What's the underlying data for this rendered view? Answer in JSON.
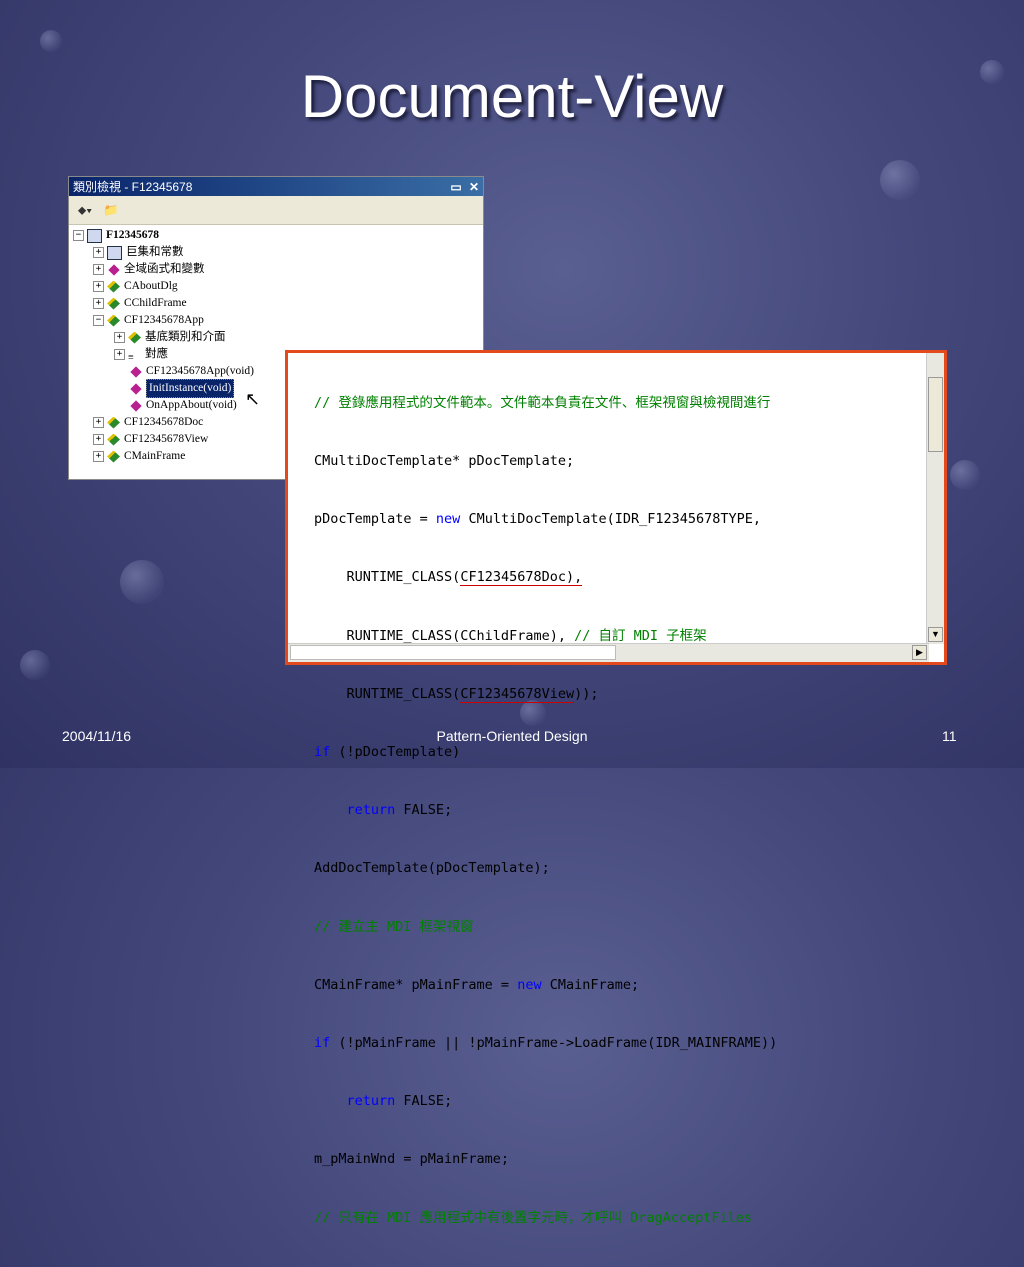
{
  "slide": {
    "title": "Document-View",
    "footer_date": "2004/11/16",
    "footer_center": "Pattern-Oriented Design",
    "footer_page": "11"
  },
  "classview": {
    "title": "類別檢視 - F12345678",
    "pin_icon": "pin-icon",
    "close_label": "✕",
    "items": [
      {
        "label": "F12345678",
        "expander": "−",
        "icon": "project-icon"
      },
      {
        "label": "巨集和常數",
        "expander": "+",
        "icon": "macro-icon"
      },
      {
        "label": "全域函式和變數",
        "expander": "+",
        "icon": "globals-icon"
      },
      {
        "label": "CAboutDlg",
        "expander": "+",
        "icon": "class-icon"
      },
      {
        "label": "CChildFrame",
        "expander": "+",
        "icon": "class-icon"
      },
      {
        "label": "CF12345678App",
        "expander": "−",
        "icon": "class-icon"
      },
      {
        "label": "基底類別和介面",
        "expander": "+",
        "icon": "base-class-icon"
      },
      {
        "label": "對應",
        "expander": "+",
        "icon": "map-icon"
      },
      {
        "label": "CF12345678App(void)",
        "expander": "",
        "icon": "method-icon"
      },
      {
        "label": "InitInstance(void)",
        "expander": "",
        "icon": "method-icon"
      },
      {
        "label": "OnAppAbout(void)",
        "expander": "",
        "icon": "method-icon"
      },
      {
        "label": "CF12345678Doc",
        "expander": "+",
        "icon": "class-icon"
      },
      {
        "label": "CF12345678View",
        "expander": "+",
        "icon": "class-icon"
      },
      {
        "label": "CMainFrame",
        "expander": "+",
        "icon": "class-icon"
      }
    ]
  },
  "code": {
    "lines": [
      "// 登錄應用程式的文件範本。文件範本負責在文件、框架視窗與檢視間進行",
      "CMultiDocTemplate* pDocTemplate;",
      "pDocTemplate = new CMultiDocTemplate(IDR_F12345678TYPE,",
      "    RUNTIME_CLASS(CF12345678Doc),",
      "    RUNTIME_CLASS(CChildFrame), // 自訂 MDI 子框架",
      "    RUNTIME_CLASS(CF12345678View));",
      "if (!pDocTemplate)",
      "    return FALSE;",
      "AddDocTemplate(pDocTemplate);",
      "// 建立主 MDI 框架視窗",
      "CMainFrame* pMainFrame = new CMainFrame;",
      "if (!pMainFrame || !pMainFrame->LoadFrame(IDR_MAINFRAME))",
      "    return FALSE;",
      "m_pMainWnd = pMainFrame;",
      "// 只有在 MDI 應用程式中有後置字元時，才呼叫 DragAcceptFiles"
    ]
  },
  "colors": {
    "highlight_border": "#e24a1e",
    "comment": "#008000",
    "keyword": "#0000ff"
  }
}
